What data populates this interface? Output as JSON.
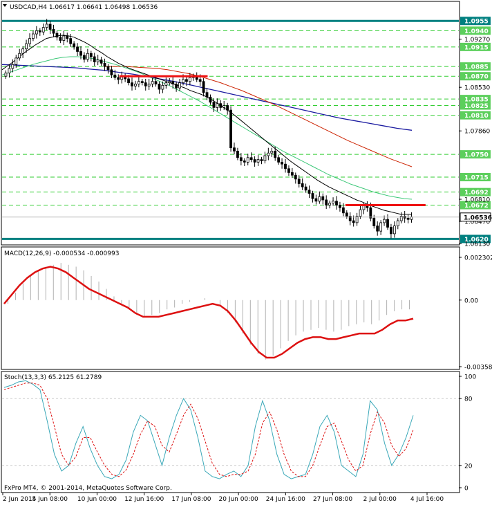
{
  "chart_data": {
    "type": "candlestick",
    "symbol": "USDCAD,H4",
    "title": "USDCAD,H4  1.06617 1.06641 1.06498 1.06536",
    "ohlc_header": "1.06617 1.06641 1.06498 1.06536",
    "copyright": "FxPro MT4, © 2001-2014, MetaQuotes Software Corp.",
    "ylim": [
      1.0613,
      1.0968
    ],
    "close_series": [
      1.0875,
      1.0882,
      1.0888,
      1.0898,
      1.0905,
      1.0912,
      1.092,
      1.0928,
      1.0935,
      1.094,
      1.0938,
      1.0945,
      1.095,
      1.0942,
      1.0936,
      1.093,
      1.0925,
      1.0932,
      1.0928,
      1.092,
      1.0915,
      1.0908,
      1.0902,
      1.0896,
      1.0905,
      1.09,
      1.0892,
      1.0895,
      1.089,
      1.0885,
      1.088,
      1.0872,
      1.0868,
      1.0865,
      1.087,
      1.0866,
      1.086,
      1.0855,
      1.0858,
      1.0862,
      1.086,
      1.0855,
      1.0858,
      1.0862,
      1.0858,
      1.085,
      1.0856,
      1.086,
      1.0862,
      1.0858,
      1.0852,
      1.086,
      1.0865,
      1.0862,
      1.0868,
      1.087,
      1.0865,
      1.0862,
      1.0845,
      1.0838,
      1.083,
      1.0822,
      1.0828,
      1.0822,
      1.0825,
      1.0818,
      1.076,
      1.0755,
      1.0745,
      1.074,
      1.0738,
      1.0745,
      1.0742,
      1.0738,
      1.0742,
      1.074,
      1.0748,
      1.0752,
      1.0755,
      1.0745,
      1.0738,
      1.0735,
      1.0728,
      1.0722,
      1.0718,
      1.0712,
      1.0705,
      1.07,
      1.0695,
      1.069,
      1.0682,
      1.0678,
      1.0685,
      1.068,
      1.0672,
      1.0675,
      1.0678,
      1.0672,
      1.0668,
      1.066,
      1.0655,
      1.0648,
      1.0645,
      1.0655,
      1.0665,
      1.0672,
      1.0668,
      1.0652,
      1.064,
      1.0632,
      1.0645,
      1.065,
      1.0638,
      1.0628,
      1.064,
      1.0648,
      1.0655,
      1.0652,
      1.065,
      1.0654
    ],
    "ma_fast": [
      1.088,
      1.0886,
      1.0892,
      1.0899,
      1.0906,
      1.0912,
      1.0918,
      1.0923,
      1.0928,
      1.093,
      1.0932,
      1.0933,
      1.0932,
      1.093,
      1.0926,
      1.0922,
      1.0917,
      1.0911,
      1.0906,
      1.09,
      1.0895,
      1.089,
      1.0886,
      1.0882,
      1.0879,
      1.0876,
      1.0873,
      1.087,
      1.0867,
      1.0864,
      1.0861,
      1.0858,
      1.0855,
      1.0852,
      1.0848,
      1.0845,
      1.0842,
      1.0838,
      1.0833,
      1.0828,
      1.0822,
      1.0816,
      1.081,
      1.0803,
      1.0796,
      1.0789,
      1.0782,
      1.0775,
      1.0768,
      1.0761,
      1.0754,
      1.0747,
      1.074,
      1.0734,
      1.0728,
      1.0722,
      1.0716,
      1.071,
      1.0705,
      1.07,
      1.0696,
      1.0692,
      1.0688,
      1.0684,
      1.068,
      1.0677,
      1.0673,
      1.067,
      1.0667,
      1.0664,
      1.0662,
      1.066,
      1.0658,
      1.0658,
      1.0658
    ],
    "ma_green": [
      1.0872,
      1.0876,
      1.088,
      1.0884,
      1.0888,
      1.0891,
      1.0894,
      1.0897,
      1.0899,
      1.09,
      1.09,
      1.0899,
      1.0897,
      1.0894,
      1.0891,
      1.0888,
      1.0884,
      1.088,
      1.0876,
      1.0871,
      1.0866,
      1.0861,
      1.0856,
      1.085,
      1.0844,
      1.0838,
      1.0832,
      1.0825,
      1.0818,
      1.0811,
      1.0804,
      1.0797,
      1.079,
      1.0783,
      1.0776,
      1.0769,
      1.0762,
      1.0755,
      1.0749,
      1.0743,
      1.0737,
      1.0731,
      1.0725,
      1.0719,
      1.0714,
      1.0709,
      1.0704,
      1.07,
      1.0696,
      1.0692,
      1.0689,
      1.0686,
      1.0684,
      1.0682,
      1.0681
    ],
    "ma_red": [
      1.0885,
      1.0885,
      1.0885,
      1.0884,
      1.0883,
      1.0882,
      1.088,
      1.0877,
      1.0874,
      1.087,
      1.0865,
      1.086,
      1.0854,
      1.0848,
      1.0841,
      1.0834,
      1.0827,
      1.0819,
      1.0811,
      1.0803,
      1.0795,
      1.0787,
      1.0779,
      1.0771,
      1.0764,
      1.0757,
      1.075,
      1.0743,
      1.0737,
      1.0731
    ],
    "ma_navy": [
      1.0888,
      1.0887,
      1.0886,
      1.0885,
      1.0884,
      1.0883,
      1.0881,
      1.0879,
      1.0876,
      1.0873,
      1.0869,
      1.0865,
      1.0861,
      1.0856,
      1.0851,
      1.0846,
      1.0841,
      1.0836,
      1.0831,
      1.0826,
      1.0821,
      1.0816,
      1.0811,
      1.0806,
      1.0802,
      1.0798,
      1.0794,
      1.079,
      1.0787
    ],
    "levels": [
      {
        "label": "1.0955",
        "value": 1.0955,
        "color": "#008080",
        "kind": "major"
      },
      {
        "label": "1.0940",
        "value": 1.094,
        "color": "#32cd32",
        "kind": "dash"
      },
      {
        "label": "1.0915",
        "value": 1.0915,
        "color": "#32cd32",
        "kind": "dash"
      },
      {
        "label": "1.0885",
        "value": 1.0885,
        "color": "#32cd32",
        "kind": "dash"
      },
      {
        "label": "1.0870",
        "value": 1.087,
        "color": "#32cd32",
        "kind": "dash"
      },
      {
        "label": "1.0835",
        "value": 1.0835,
        "color": "#32cd32",
        "kind": "dash"
      },
      {
        "label": "1.0825",
        "value": 1.0825,
        "color": "#32cd32",
        "kind": "dash"
      },
      {
        "label": "1.0810",
        "value": 1.081,
        "color": "#32cd32",
        "kind": "dash"
      },
      {
        "label": "1.0750",
        "value": 1.075,
        "color": "#32cd32",
        "kind": "dash"
      },
      {
        "label": "1.0715",
        "value": 1.0715,
        "color": "#32cd32",
        "kind": "dash"
      },
      {
        "label": "1.0692",
        "value": 1.0692,
        "color": "#32cd32",
        "kind": "dash"
      },
      {
        "label": "1.0672",
        "value": 1.0672,
        "color": "#32cd32",
        "kind": "dash"
      },
      {
        "label": "1.0620",
        "value": 1.062,
        "color": "#008080",
        "kind": "major"
      }
    ],
    "level_labels": [
      "1.0955",
      "1.0940",
      "1.0915",
      "1.0885",
      "1.0870",
      "1.0835",
      "1.0825",
      "1.0810",
      "1.0750",
      "1.0715",
      "1.0692",
      "1.0672",
      "1.0620"
    ],
    "gray_ticks": [
      {
        "label": "1.09270",
        "value": 1.0927
      },
      {
        "label": "1.08530",
        "value": 1.0853
      },
      {
        "label": "1.07860",
        "value": 1.0786
      },
      {
        "label": "1.06810",
        "value": 1.0681
      },
      {
        "label": "1.06470",
        "value": 1.0647
      },
      {
        "label": "1.06130",
        "value": 1.0613
      }
    ],
    "gray_tick_labels": [
      "1.09270",
      "1.08530",
      "1.07860",
      "1.06810",
      "1.06470",
      "1.06130"
    ],
    "current_price": {
      "label": "1.06536",
      "value": 1.06536
    },
    "resistance_lines": [
      {
        "value": 1.087,
        "from": 0.285,
        "to": 0.5
      },
      {
        "value": 1.0672,
        "from": 0.835,
        "to": 1.03
      }
    ],
    "time_labels": [
      "2 Jun 2014",
      "5 Jun 08:00",
      "10 Jun 00:00",
      "12 Jun 16:00",
      "17 Jun 08:00",
      "20 Jun 00:00",
      "24 Jun 16:00",
      "27 Jun 08:00",
      "2 Jul 00:00",
      "4 Jul 16:00"
    ],
    "macd": {
      "label": "MACD(12,26,9) -0.000534 -0.000993",
      "ticks": [
        "0.002302",
        "0.00",
        "-0.003586"
      ],
      "ylim": [
        -0.003586,
        0.002302
      ],
      "histogram": [
        -0.0002,
        0.0004,
        0.0009,
        0.0013,
        0.0016,
        0.0018,
        0.0019,
        0.002,
        0.0019,
        0.0018,
        0.0016,
        0.0013,
        0.001,
        0.0006,
        0.0002,
        -0.0002,
        -0.0005,
        -0.0008,
        -0.0009,
        -0.0008,
        -0.0007,
        -0.0005,
        -0.0004,
        -0.0002,
        -0.0001,
        0.0,
        0.0001,
        0.0,
        -0.0003,
        -0.0007,
        -0.0012,
        -0.0018,
        -0.0024,
        -0.0029,
        -0.0032,
        -0.003,
        -0.0026,
        -0.0022,
        -0.0019,
        -0.0017,
        -0.0016,
        -0.0015,
        -0.0016,
        -0.0017,
        -0.0016,
        -0.0014,
        -0.0013,
        -0.0012,
        -0.0013,
        -0.0011,
        -0.0008,
        -0.0006,
        -0.0005,
        -0.0005
      ],
      "signal": [
        -0.0002,
        0.0003,
        0.0008,
        0.0012,
        0.0015,
        0.0017,
        0.0018,
        0.0017,
        0.0015,
        0.0012,
        0.0009,
        0.0006,
        0.0004,
        0.0002,
        0.0,
        -0.0002,
        -0.0004,
        -0.0007,
        -0.0009,
        -0.0009,
        -0.0009,
        -0.0008,
        -0.0007,
        -0.0006,
        -0.0005,
        -0.0004,
        -0.0003,
        -0.0002,
        -0.0003,
        -0.0006,
        -0.0011,
        -0.0017,
        -0.0023,
        -0.0028,
        -0.0031,
        -0.0031,
        -0.0029,
        -0.0026,
        -0.0023,
        -0.0021,
        -0.002,
        -0.002,
        -0.0021,
        -0.0021,
        -0.002,
        -0.0019,
        -0.0018,
        -0.0018,
        -0.0018,
        -0.0016,
        -0.0013,
        -0.0011,
        -0.0011,
        -0.001
      ]
    },
    "stoch": {
      "label": "Stoch(13,3,3) 65.2125 61.2789",
      "ticks": [
        "100",
        "80",
        "20",
        "0"
      ],
      "ylim": [
        0,
        100
      ],
      "main": [
        90,
        92,
        95,
        96,
        93,
        88,
        60,
        30,
        15,
        20,
        40,
        55,
        35,
        20,
        10,
        8,
        12,
        25,
        50,
        65,
        60,
        40,
        20,
        45,
        65,
        80,
        70,
        45,
        15,
        10,
        8,
        12,
        15,
        10,
        20,
        55,
        78,
        60,
        30,
        12,
        8,
        10,
        12,
        30,
        55,
        65,
        50,
        20,
        15,
        10,
        30,
        78,
        70,
        40,
        20,
        30,
        45,
        65
      ],
      "signal": [
        88,
        90,
        92,
        94,
        94,
        92,
        80,
        55,
        30,
        20,
        28,
        45,
        45,
        32,
        20,
        12,
        10,
        16,
        30,
        48,
        60,
        55,
        38,
        32,
        48,
        65,
        75,
        62,
        42,
        22,
        12,
        10,
        12,
        12,
        15,
        30,
        58,
        68,
        52,
        30,
        15,
        10,
        10,
        20,
        38,
        55,
        58,
        42,
        25,
        15,
        20,
        48,
        68,
        58,
        38,
        28,
        35,
        52
      ]
    }
  }
}
